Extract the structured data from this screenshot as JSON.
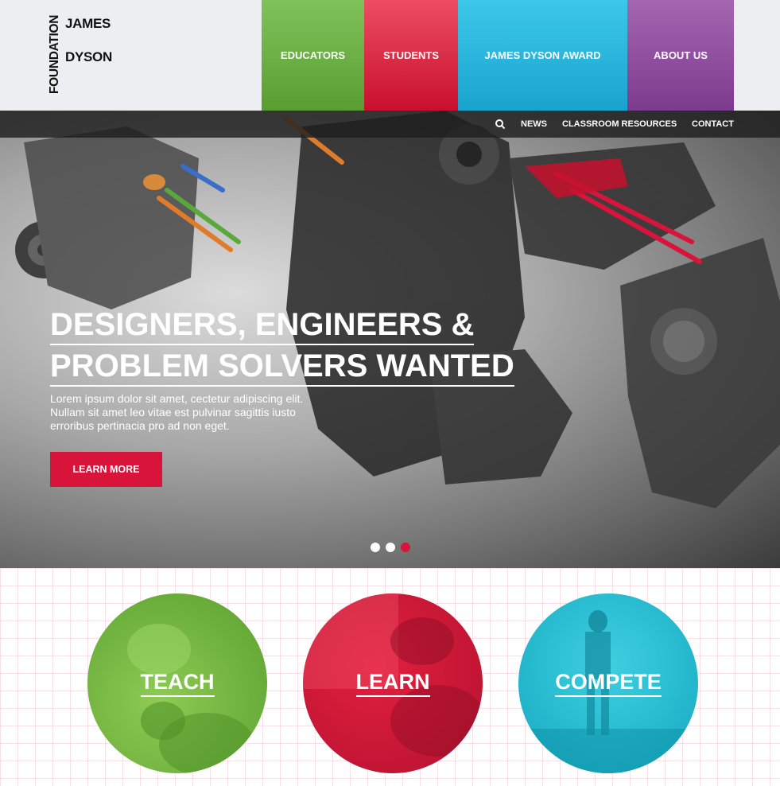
{
  "logo": {
    "vertical": "FOUNDATION",
    "word1": "JAMES",
    "word2": "DYSON"
  },
  "nav": {
    "educators": "EDUCATORS",
    "students": "STUDENTS",
    "award": "JAMES DYSON AWARD",
    "about": "ABOUT US"
  },
  "subnav": {
    "news": "NEWS",
    "resources": "CLASSROOM RESOURCES",
    "contact": "CONTACT"
  },
  "hero": {
    "title_line1": "DESIGNERS, ENGINEERS &",
    "title_line2": "PROBLEM SOLVERS WANTED",
    "body": "Lorem ipsum dolor sit amet, cectetur adipiscing elit. Nullam sit amet leo vitae est pulvinar sagittis iusto erroribus pertinacia pro ad non eget.",
    "cta": "LEARN MORE"
  },
  "carousel": {
    "active_index": 2,
    "count": 3
  },
  "circles": {
    "teach": "TEACH",
    "learn": "LEARN",
    "compete": "COMPETE"
  },
  "colors": {
    "green": "#6ab04c",
    "red": "#d8143a",
    "cyan": "#1fb8dc",
    "purple": "#8e4c9e"
  }
}
